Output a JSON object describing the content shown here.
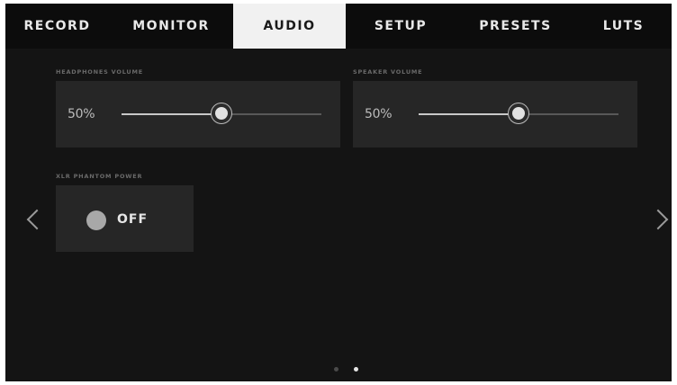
{
  "tabs": [
    {
      "label": "RECORD",
      "active": false
    },
    {
      "label": "MONITOR",
      "active": false
    },
    {
      "label": "AUDIO",
      "active": true
    },
    {
      "label": "SETUP",
      "active": false
    },
    {
      "label": "PRESETS",
      "active": false
    },
    {
      "label": "LUTS",
      "active": false
    }
  ],
  "headphones": {
    "label": "HEADPHONES VOLUME",
    "value_text": "50%",
    "level": 0.5
  },
  "speaker": {
    "label": "SPEAKER VOLUME",
    "value_text": "50%",
    "level": 0.5
  },
  "phantom_power": {
    "label": "XLR PHANTOM POWER",
    "state": "OFF"
  },
  "pager": {
    "total": 2,
    "current": 2
  },
  "icons": {
    "prev": "chevron-left-icon",
    "next": "chevron-right-icon"
  },
  "colors": {
    "background": "#141414",
    "tab_bar": "#0c0c0c",
    "active_tab": "#f1f1f1",
    "panel": "#262626"
  }
}
